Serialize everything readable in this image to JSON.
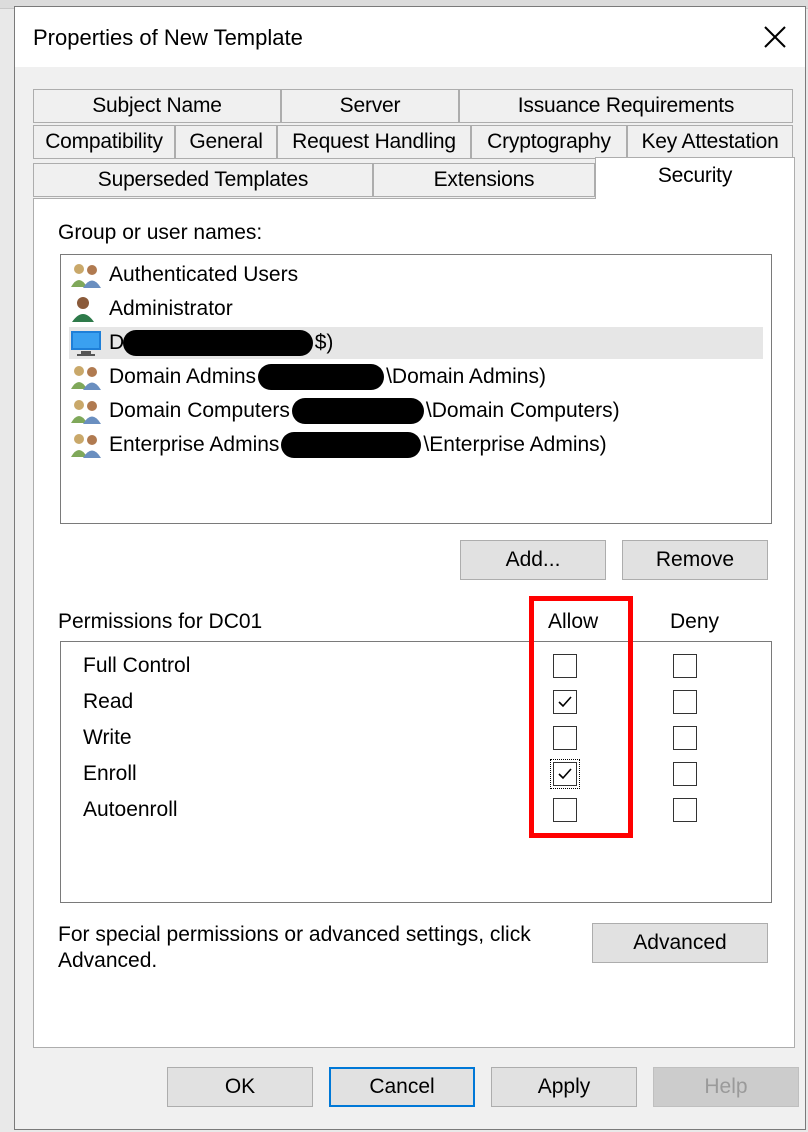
{
  "window": {
    "title": "Properties of New Template"
  },
  "tabs": {
    "row1": [
      "Subject Name",
      "Server",
      "Issuance Requirements"
    ],
    "row2": [
      "Compatibility",
      "General",
      "Request Handling",
      "Cryptography",
      "Key Attestation"
    ],
    "row3": [
      "Superseded Templates",
      "Extensions",
      "Security"
    ],
    "active": "Security"
  },
  "security": {
    "group_label": "Group or user names:",
    "users": [
      {
        "prefix": "Authenticated Users",
        "suffix": ""
      },
      {
        "prefix": "Administrator",
        "suffix": ""
      },
      {
        "prefix": "DC01",
        "suffix": "$)"
      },
      {
        "prefix": "Domain Admins",
        "suffix": "\\Domain Admins)"
      },
      {
        "prefix": "Domain Computers",
        "suffix": "\\Domain Computers)"
      },
      {
        "prefix": "Enterprise Admins",
        "suffix": "\\Enterprise Admins)"
      }
    ],
    "selected_user_index": 2,
    "add_label": "Add...",
    "remove_label": "Remove",
    "permissions_label": "Permissions for DC01",
    "allow_header": "Allow",
    "deny_header": "Deny",
    "permissions": [
      {
        "name": "Full Control",
        "allow": false,
        "deny": false
      },
      {
        "name": "Read",
        "allow": true,
        "deny": false
      },
      {
        "name": "Write",
        "allow": false,
        "deny": false
      },
      {
        "name": "Enroll",
        "allow": true,
        "deny": false
      },
      {
        "name": "Autoenroll",
        "allow": false,
        "deny": false
      }
    ],
    "advanced_text_line1": "For special permissions or advanced settings, click",
    "advanced_text_line2": "Advanced.",
    "advanced_label": "Advanced"
  },
  "footer": {
    "ok": "OK",
    "cancel": "Cancel",
    "apply": "Apply",
    "help": "Help"
  },
  "colors": {
    "highlight": "#ff0000",
    "focus_border": "#0078d7",
    "selection": "#e6e6e6"
  }
}
